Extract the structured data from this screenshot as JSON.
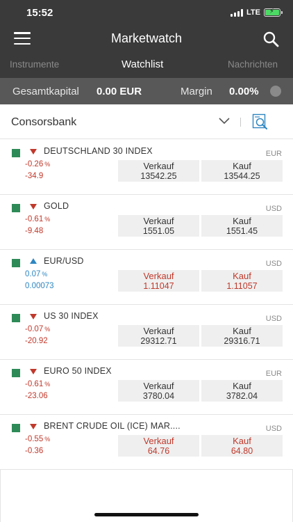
{
  "status": {
    "time": "15:52",
    "network": "LTE"
  },
  "nav": {
    "title": "Marketwatch"
  },
  "tabs": [
    {
      "label": "Instrumente"
    },
    {
      "label": "Watchlist"
    },
    {
      "label": "Nachrichten"
    }
  ],
  "capital": {
    "label": "Gesamtkapital",
    "value": "0.00 EUR",
    "margin_label": "Margin",
    "margin_value": "0.00%"
  },
  "broker": {
    "name": "Consorsbank"
  },
  "instruments": [
    {
      "name": "DEUTSCHLAND 30 INDEX",
      "currency": "EUR",
      "trend": "down",
      "change_pct": "-0.26",
      "pct_unit": "%",
      "change_abs": "-34.9",
      "sell_label": "Verkauf",
      "sell": "13542.25",
      "buy_label": "Kauf",
      "buy": "13544.25",
      "price_color": "neutral"
    },
    {
      "name": "GOLD",
      "currency": "USD",
      "trend": "down",
      "change_pct": "-0.61",
      "pct_unit": "%",
      "change_abs": "-9.48",
      "sell_label": "Verkauf",
      "sell": "1551.05",
      "buy_label": "Kauf",
      "buy": "1551.45",
      "price_color": "neutral"
    },
    {
      "name": "EUR/USD",
      "currency": "USD",
      "trend": "up",
      "change_pct": "0.07",
      "pct_unit": "%",
      "change_abs": "0.00073",
      "sell_label": "Verkauf",
      "sell": "1.11047",
      "buy_label": "Kauf",
      "buy": "1.11057",
      "price_color": "red"
    },
    {
      "name": "US 30 INDEX",
      "currency": "USD",
      "trend": "down",
      "change_pct": "-0.07",
      "pct_unit": "%",
      "change_abs": "-20.92",
      "sell_label": "Verkauf",
      "sell": "29312.71",
      "buy_label": "Kauf",
      "buy": "29316.71",
      "price_color": "neutral"
    },
    {
      "name": "EURO 50 INDEX",
      "currency": "EUR",
      "trend": "down",
      "change_pct": "-0.61",
      "pct_unit": "%",
      "change_abs": "-23.06",
      "sell_label": "Verkauf",
      "sell": "3780.04",
      "buy_label": "Kauf",
      "buy": "3782.04",
      "price_color": "neutral"
    },
    {
      "name": "BRENT CRUDE OIL (ICE) MAR....",
      "currency": "USD",
      "trend": "down",
      "change_pct": "-0.55",
      "pct_unit": "%",
      "change_abs": "-0.36",
      "sell_label": "Verkauf",
      "sell": "64.76",
      "buy_label": "Kauf",
      "buy": "64.80",
      "price_color": "red"
    }
  ],
  "icons": {
    "menu": "menu-icon",
    "search": "search-icon",
    "dropdown": "chevron-down-icon",
    "filter": "document-search-icon",
    "trend_down": "triangle-down-icon",
    "trend_up": "triangle-up-icon",
    "favorite": "square-icon"
  },
  "colors": {
    "header_bg": "#3a3a3a",
    "capital_bg": "#585858",
    "negative": "#c0392b",
    "positive": "#2e86c1",
    "square": "#2e8b57",
    "battery": "#4cd964"
  }
}
